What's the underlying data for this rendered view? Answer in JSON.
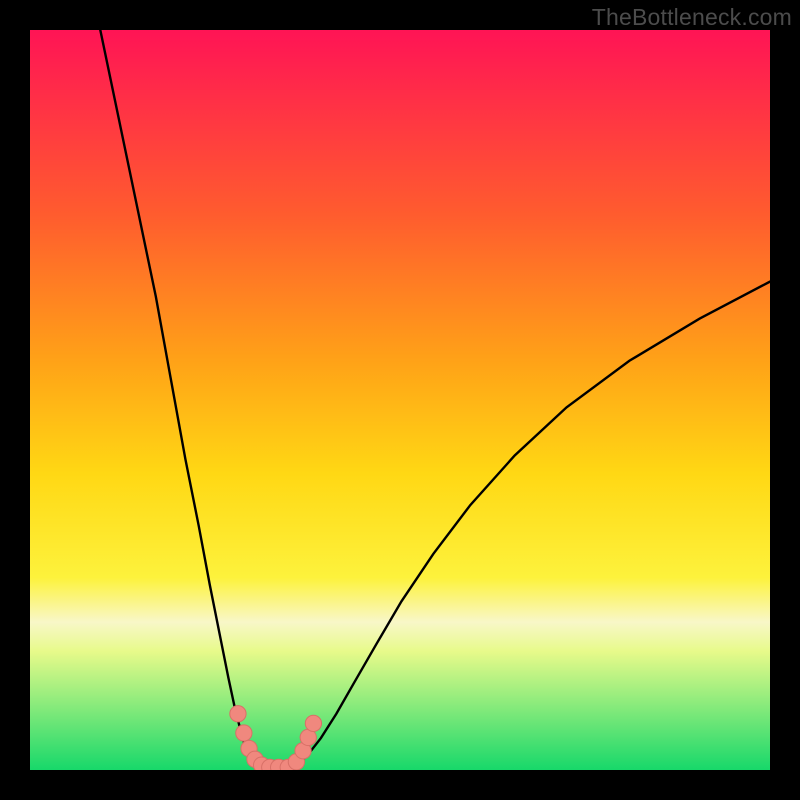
{
  "watermark": "TheBottleneck.com",
  "colors": {
    "grad_top": "#ff1455",
    "grad_25": "#ff5c2e",
    "grad_45": "#ffa317",
    "grad_60": "#ffd814",
    "grad_74": "#fdf23c",
    "grad_80_pale": "#f8f7c8",
    "grad_84": "#e7fa8a",
    "grad_bottom": "#17d86a",
    "curve": "#000000",
    "marker_fill": "#f0887e",
    "marker_stroke": "#d87067"
  },
  "chart_data": {
    "type": "line",
    "title": "",
    "xlabel": "",
    "ylabel": "",
    "xlim": [
      0,
      100
    ],
    "ylim": [
      0,
      100
    ],
    "series": [
      {
        "name": "left-branch",
        "x": [
          9.5,
          12,
          14.5,
          17,
          19,
          21,
          22.8,
          24.3,
          25.7,
          26.8,
          27.7,
          28.5,
          29.1,
          29.7,
          30.2
        ],
        "y": [
          100,
          88,
          76,
          64,
          53,
          42,
          33,
          25,
          18,
          12.5,
          8.3,
          5.2,
          3.1,
          1.6,
          0.6
        ]
      },
      {
        "name": "valley",
        "x": [
          30.2,
          31.5,
          33,
          34.5,
          36
        ],
        "y": [
          0.6,
          0.15,
          0.05,
          0.15,
          0.6
        ]
      },
      {
        "name": "right-branch",
        "x": [
          36,
          37.5,
          39.3,
          41.4,
          43.8,
          46.8,
          50.2,
          54.5,
          59.5,
          65.5,
          72.5,
          81,
          90.5,
          100
        ],
        "y": [
          0.6,
          2.0,
          4.3,
          7.6,
          11.8,
          17,
          22.8,
          29.2,
          35.8,
          42.5,
          49,
          55.3,
          61,
          66
        ]
      }
    ],
    "markers": {
      "name": "valley-markers",
      "points": [
        {
          "x": 28.1,
          "y": 7.6
        },
        {
          "x": 28.9,
          "y": 5.0
        },
        {
          "x": 29.6,
          "y": 2.9
        },
        {
          "x": 30.4,
          "y": 1.45
        },
        {
          "x": 31.3,
          "y": 0.65
        },
        {
          "x": 32.4,
          "y": 0.35
        },
        {
          "x": 33.6,
          "y": 0.35
        },
        {
          "x": 34.9,
          "y": 0.35
        },
        {
          "x": 36.0,
          "y": 1.1
        },
        {
          "x": 36.9,
          "y": 2.6
        },
        {
          "x": 37.6,
          "y": 4.4
        },
        {
          "x": 38.3,
          "y": 6.3
        }
      ],
      "radius": 1.1
    }
  }
}
